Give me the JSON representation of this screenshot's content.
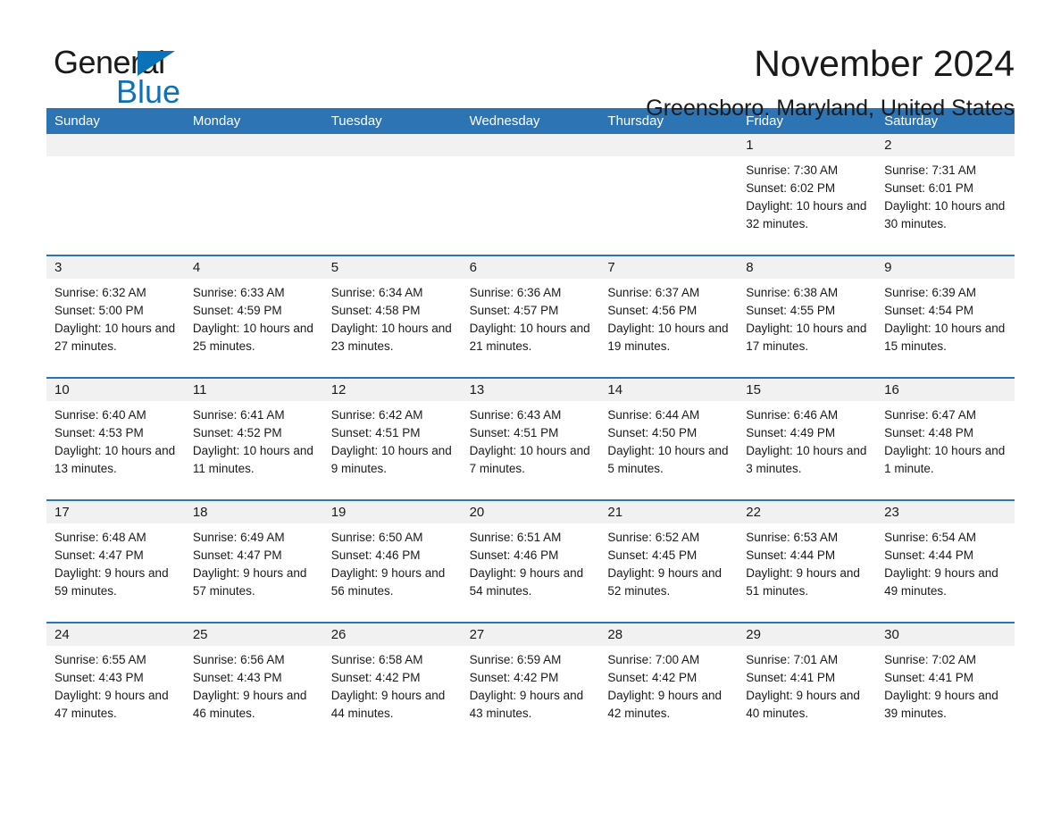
{
  "logo": {
    "word1": "General",
    "word2": "Blue",
    "triangle_color": "#0b72b9"
  },
  "header": {
    "month_title": "November 2024",
    "location": "Greensboro, Maryland, United States"
  },
  "theme": {
    "header_blue": "#2d74b5",
    "daynum_bg": "#f1f1f1",
    "text": "#1a1a1a"
  },
  "weekdays": [
    "Sunday",
    "Monday",
    "Tuesday",
    "Wednesday",
    "Thursday",
    "Friday",
    "Saturday"
  ],
  "weeks": [
    [
      {
        "empty": true
      },
      {
        "empty": true
      },
      {
        "empty": true
      },
      {
        "empty": true
      },
      {
        "empty": true
      },
      {
        "day": "1",
        "sunrise": "Sunrise: 7:30 AM",
        "sunset": "Sunset: 6:02 PM",
        "daylight": "Daylight: 10 hours and 32 minutes."
      },
      {
        "day": "2",
        "sunrise": "Sunrise: 7:31 AM",
        "sunset": "Sunset: 6:01 PM",
        "daylight": "Daylight: 10 hours and 30 minutes."
      }
    ],
    [
      {
        "day": "3",
        "sunrise": "Sunrise: 6:32 AM",
        "sunset": "Sunset: 5:00 PM",
        "daylight": "Daylight: 10 hours and 27 minutes."
      },
      {
        "day": "4",
        "sunrise": "Sunrise: 6:33 AM",
        "sunset": "Sunset: 4:59 PM",
        "daylight": "Daylight: 10 hours and 25 minutes."
      },
      {
        "day": "5",
        "sunrise": "Sunrise: 6:34 AM",
        "sunset": "Sunset: 4:58 PM",
        "daylight": "Daylight: 10 hours and 23 minutes."
      },
      {
        "day": "6",
        "sunrise": "Sunrise: 6:36 AM",
        "sunset": "Sunset: 4:57 PM",
        "daylight": "Daylight: 10 hours and 21 minutes."
      },
      {
        "day": "7",
        "sunrise": "Sunrise: 6:37 AM",
        "sunset": "Sunset: 4:56 PM",
        "daylight": "Daylight: 10 hours and 19 minutes."
      },
      {
        "day": "8",
        "sunrise": "Sunrise: 6:38 AM",
        "sunset": "Sunset: 4:55 PM",
        "daylight": "Daylight: 10 hours and 17 minutes."
      },
      {
        "day": "9",
        "sunrise": "Sunrise: 6:39 AM",
        "sunset": "Sunset: 4:54 PM",
        "daylight": "Daylight: 10 hours and 15 minutes."
      }
    ],
    [
      {
        "day": "10",
        "sunrise": "Sunrise: 6:40 AM",
        "sunset": "Sunset: 4:53 PM",
        "daylight": "Daylight: 10 hours and 13 minutes."
      },
      {
        "day": "11",
        "sunrise": "Sunrise: 6:41 AM",
        "sunset": "Sunset: 4:52 PM",
        "daylight": "Daylight: 10 hours and 11 minutes."
      },
      {
        "day": "12",
        "sunrise": "Sunrise: 6:42 AM",
        "sunset": "Sunset: 4:51 PM",
        "daylight": "Daylight: 10 hours and 9 minutes."
      },
      {
        "day": "13",
        "sunrise": "Sunrise: 6:43 AM",
        "sunset": "Sunset: 4:51 PM",
        "daylight": "Daylight: 10 hours and 7 minutes."
      },
      {
        "day": "14",
        "sunrise": "Sunrise: 6:44 AM",
        "sunset": "Sunset: 4:50 PM",
        "daylight": "Daylight: 10 hours and 5 minutes."
      },
      {
        "day": "15",
        "sunrise": "Sunrise: 6:46 AM",
        "sunset": "Sunset: 4:49 PM",
        "daylight": "Daylight: 10 hours and 3 minutes."
      },
      {
        "day": "16",
        "sunrise": "Sunrise: 6:47 AM",
        "sunset": "Sunset: 4:48 PM",
        "daylight": "Daylight: 10 hours and 1 minute."
      }
    ],
    [
      {
        "day": "17",
        "sunrise": "Sunrise: 6:48 AM",
        "sunset": "Sunset: 4:47 PM",
        "daylight": "Daylight: 9 hours and 59 minutes."
      },
      {
        "day": "18",
        "sunrise": "Sunrise: 6:49 AM",
        "sunset": "Sunset: 4:47 PM",
        "daylight": "Daylight: 9 hours and 57 minutes."
      },
      {
        "day": "19",
        "sunrise": "Sunrise: 6:50 AM",
        "sunset": "Sunset: 4:46 PM",
        "daylight": "Daylight: 9 hours and 56 minutes."
      },
      {
        "day": "20",
        "sunrise": "Sunrise: 6:51 AM",
        "sunset": "Sunset: 4:46 PM",
        "daylight": "Daylight: 9 hours and 54 minutes."
      },
      {
        "day": "21",
        "sunrise": "Sunrise: 6:52 AM",
        "sunset": "Sunset: 4:45 PM",
        "daylight": "Daylight: 9 hours and 52 minutes."
      },
      {
        "day": "22",
        "sunrise": "Sunrise: 6:53 AM",
        "sunset": "Sunset: 4:44 PM",
        "daylight": "Daylight: 9 hours and 51 minutes."
      },
      {
        "day": "23",
        "sunrise": "Sunrise: 6:54 AM",
        "sunset": "Sunset: 4:44 PM",
        "daylight": "Daylight: 9 hours and 49 minutes."
      }
    ],
    [
      {
        "day": "24",
        "sunrise": "Sunrise: 6:55 AM",
        "sunset": "Sunset: 4:43 PM",
        "daylight": "Daylight: 9 hours and 47 minutes."
      },
      {
        "day": "25",
        "sunrise": "Sunrise: 6:56 AM",
        "sunset": "Sunset: 4:43 PM",
        "daylight": "Daylight: 9 hours and 46 minutes."
      },
      {
        "day": "26",
        "sunrise": "Sunrise: 6:58 AM",
        "sunset": "Sunset: 4:42 PM",
        "daylight": "Daylight: 9 hours and 44 minutes."
      },
      {
        "day": "27",
        "sunrise": "Sunrise: 6:59 AM",
        "sunset": "Sunset: 4:42 PM",
        "daylight": "Daylight: 9 hours and 43 minutes."
      },
      {
        "day": "28",
        "sunrise": "Sunrise: 7:00 AM",
        "sunset": "Sunset: 4:42 PM",
        "daylight": "Daylight: 9 hours and 42 minutes."
      },
      {
        "day": "29",
        "sunrise": "Sunrise: 7:01 AM",
        "sunset": "Sunset: 4:41 PM",
        "daylight": "Daylight: 9 hours and 40 minutes."
      },
      {
        "day": "30",
        "sunrise": "Sunrise: 7:02 AM",
        "sunset": "Sunset: 4:41 PM",
        "daylight": "Daylight: 9 hours and 39 minutes."
      }
    ]
  ]
}
